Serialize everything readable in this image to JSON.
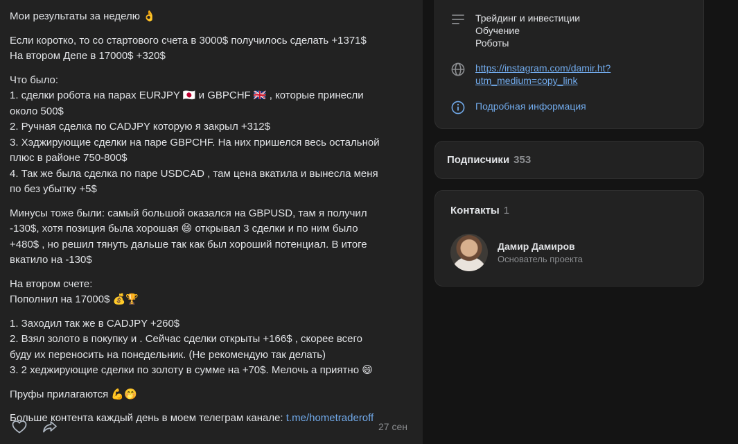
{
  "post": {
    "paragraphs": [
      {
        "lines": [
          "Мои результаты за неделю 👌"
        ]
      },
      {
        "lines": [
          "Если коротко, то со стартового счета в 3000$ получилось сделать +1371$",
          "На втором Депе в 17000$ +320$"
        ]
      },
      {
        "lines": [
          "Что было:",
          "1. сделки робота на парах EURJPY 🇯🇵 и GBPCHF 🇬🇧 , которые принесли",
          "около 500$",
          "2. Ручная сделка по CADJPY которую я закрыл +312$",
          "3. Хэджирующие сделки на паре GBPCHF. На них пришелся весь остальной",
          "плюс в районе 750-800$",
          "4. Так же была сделка по паре USDCAD , там цена вкатила и вынесла меня",
          "по без убытку +5$"
        ]
      },
      {
        "lines": [
          "Минусы тоже были: самый большой оказался на GBPUSD, там я получил",
          "-130$, хотя позиция была хорошая 😄 открывал 3 сделки и по ним было",
          "+480$ , но решил тянуть дальше так как был хороший потенциал. В итоге",
          "вкатило на -130$"
        ]
      },
      {
        "lines": [
          "На втором счете:",
          "Пополнил на 17000$ 💰🏆"
        ]
      },
      {
        "lines": [
          "1. Заходил так же в CADJPY +260$",
          "2. Взял золото в покупку и . Сейчас сделки открыты +166$ , скорее всего",
          "буду их переносить на понедельник. (Не рекомендую так делать)",
          "3. 2 хеджирующие сделки по золоту в сумме на +70$. Мелочь а приятно 😄"
        ]
      },
      {
        "lines": [
          "Пруфы прилагаются 💪🤭"
        ]
      }
    ],
    "last_line_text": "Больше контента каждый день в моем телеграм канале: ",
    "telegram_link": "t.me/hometraderoff",
    "date": "27 сен"
  },
  "info": {
    "categories": [
      "Трейдинг и инвестиции",
      "Обучение",
      "Роботы"
    ],
    "link_lines": [
      "https://instagram.com/damir.ht?",
      "utm_medium=copy_link"
    ],
    "more_info": "Подробная информация"
  },
  "subscribers": {
    "label": "Подписчики",
    "count": "353"
  },
  "contacts": {
    "label": "Контакты",
    "count": "1",
    "person": {
      "name": "Дамир Дамиров",
      "role": "Основатель проекта"
    }
  },
  "colors": {
    "background": "#141414",
    "card": "#222222",
    "link": "#71aaeb",
    "muted": "#8b8d90"
  },
  "icons": [
    "list-icon",
    "globe-icon",
    "info-icon",
    "heart-icon",
    "share-icon"
  ]
}
